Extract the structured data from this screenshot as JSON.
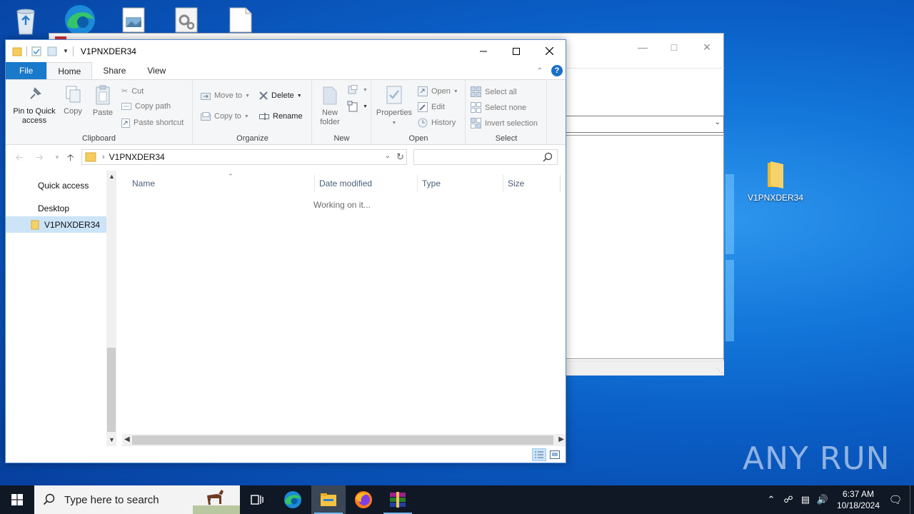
{
  "explorer": {
    "title": "V1PNXDER34",
    "tabs": [
      {
        "label": "File"
      },
      {
        "label": "Home"
      },
      {
        "label": "Share"
      },
      {
        "label": "View"
      }
    ],
    "ribbon": {
      "clipboard": {
        "label": "Clipboard",
        "pin_line1": "Pin to Quick",
        "pin_line2": "access",
        "copy": "Copy",
        "paste": "Paste",
        "cut": "Cut",
        "copy_path": "Copy path",
        "paste_shortcut": "Paste shortcut"
      },
      "organize": {
        "label": "Organize",
        "move_to": "Move to",
        "copy_to": "Copy to",
        "delete": "Delete",
        "rename": "Rename"
      },
      "new": {
        "label": "New",
        "new_line1": "New",
        "new_line2": "folder"
      },
      "open": {
        "label": "Open",
        "properties": "Properties",
        "open": "Open",
        "edit": "Edit",
        "history": "History"
      },
      "select": {
        "label": "Select",
        "select_all": "Select all",
        "select_none": "Select none",
        "invert": "Invert selection"
      }
    },
    "address": {
      "path": "V1PNXDER34"
    },
    "search": {
      "placeholder": ""
    },
    "nav": {
      "quick_access": "Quick access",
      "desktop": "Desktop",
      "folder": "V1PNXDER34"
    },
    "columns": {
      "name": "Name",
      "date_modified": "Date modified",
      "type": "Type",
      "size": "Size"
    },
    "status_message": "Working on it..."
  },
  "desktop": {
    "folder_icon_label": "V1PNXDER34",
    "watermark": "ANY RUN"
  },
  "taskbar": {
    "search_placeholder": "Type here to search",
    "time": "6:37 AM",
    "date": "10/18/2024"
  },
  "colors": {
    "accent": "#1979ca",
    "selection": "#cce4f7",
    "taskbar": "#101826"
  }
}
